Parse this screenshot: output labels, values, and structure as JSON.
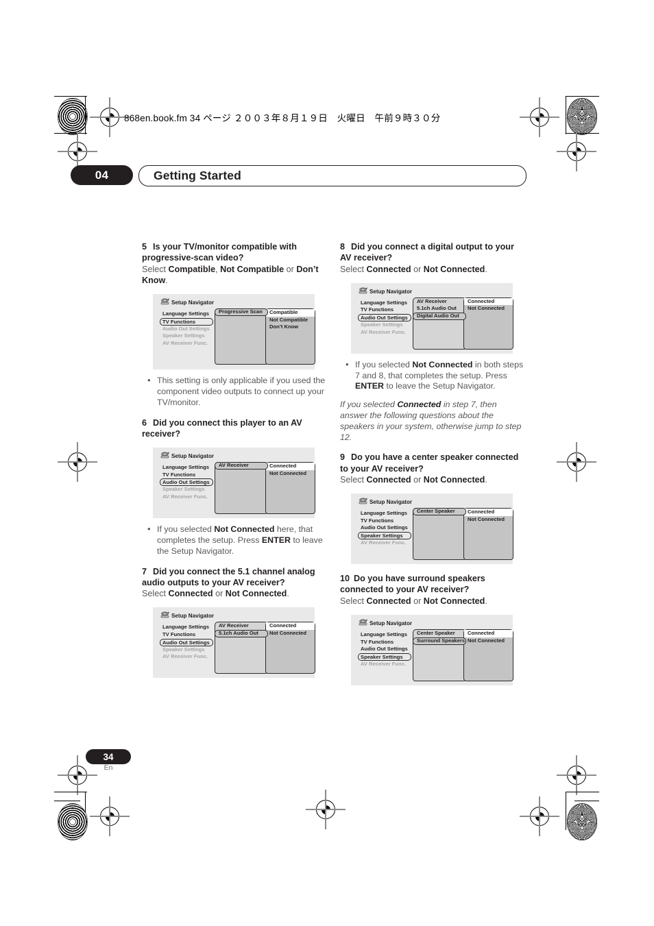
{
  "print_header": {
    "filename_line": "868en.book.fm  34 ページ  ２００３年８月１９日　火曜日　午前９時３０分"
  },
  "chapter": {
    "number": "04",
    "title": "Getting Started"
  },
  "footer": {
    "page_number": "34",
    "language_code": "En"
  },
  "osd_common": {
    "navigator_title": "Setup Navigator",
    "menu_items": [
      "Language Settings",
      "TV Functions",
      "Audio Out Settings",
      "Speaker Settings",
      "AV Receiver Func."
    ]
  },
  "left_column": {
    "step5": {
      "number": "5",
      "question": "Is your TV/monitor compatible with progressive-scan video?",
      "select_prefix": "Select ",
      "opt1": "Compatible",
      "sep1": ", ",
      "opt2": "Not Compatible",
      "sep2": " or ",
      "opt3": "Don’t Know",
      "period": ".",
      "osd": {
        "title": "Setup Navigator",
        "menu": [
          "Language Settings",
          "TV Functions",
          "Audio Out Settings",
          "Speaker Settings",
          "AV Receiver Func."
        ],
        "selected_menu_index": 1,
        "dim_from_index": 2,
        "mid_items": [
          "Progressive Scan"
        ],
        "mid_selected_index": 0,
        "right_items": [
          "Compatible",
          "Not Compatible",
          "Don’t Know"
        ],
        "right_highlight_index": 0
      }
    },
    "bullet5": {
      "text": "This setting is only applicable if you used the component video outputs to connect up your TV/monitor."
    },
    "step6": {
      "number": "6",
      "question": "Did you connect this player to an AV receiver?",
      "osd": {
        "title": "Setup Navigator",
        "menu": [
          "Language Settings",
          "TV Functions",
          "Audio Out Settings",
          "Speaker Settings",
          "AV Receiver Func."
        ],
        "selected_menu_index": 2,
        "dim_from_index": 3,
        "mid_items": [
          "AV Receiver"
        ],
        "mid_selected_index": 0,
        "right_items": [
          "Connected",
          "Not Connected"
        ],
        "right_highlight_index": 0
      }
    },
    "bullet6": {
      "part1": "If you selected ",
      "b1": "Not Connected",
      "part2": " here, that completes the setup. Press ",
      "b2": "ENTER",
      "part3": " to leave the Setup Navigator."
    },
    "step7": {
      "number": "7",
      "question": "Did you connect the 5.1 channel analog audio outputs to your AV receiver?",
      "select_prefix": "Select ",
      "opt1": "Connected",
      "sep1": " or ",
      "opt2": "Not Connected",
      "period": ".",
      "osd": {
        "title": "Setup Navigator",
        "menu": [
          "Language Settings",
          "TV Functions",
          "Audio Out Settings",
          "Speaker Settings",
          "AV Receiver Func."
        ],
        "selected_menu_index": 2,
        "dim_from_index": 3,
        "mid_items": [
          "AV Receiver",
          "5.1ch Audio Out"
        ],
        "mid_selected_index": 1,
        "right_items": [
          "Connected",
          "Not Connected"
        ],
        "right_highlight_index": 0
      }
    }
  },
  "right_column": {
    "step8": {
      "number": "8",
      "question": "Did you connect a digital output to your AV receiver?",
      "select_prefix": "Select ",
      "opt1": "Connected",
      "sep1": " or ",
      "opt2": "Not Connected",
      "period": ".",
      "osd": {
        "title": "Setup Navigator",
        "menu": [
          "Language Settings",
          "TV Functions",
          "Audio Out Settings",
          "Speaker Settings",
          "AV Receiver Func."
        ],
        "selected_menu_index": 2,
        "dim_from_index": 3,
        "mid_items": [
          "AV Receiver",
          "5.1ch Audio Out",
          "Digital Audio Out"
        ],
        "mid_selected_index": 2,
        "right_items": [
          "Connected",
          "Not Connected"
        ],
        "right_highlight_index": 0
      }
    },
    "bullet8": {
      "part1": "If you selected ",
      "b1": "Not Connected",
      "part2": " in both steps 7 and 8, that completes the setup. Press ",
      "b2": "ENTER",
      "part3": " to leave the Setup Navigator."
    },
    "note8": {
      "part1": "If you selected ",
      "b1": "Connected",
      "part2": " in step 7, then answer the following questions about the speakers in your system, otherwise jump to step 12."
    },
    "step9": {
      "number": "9",
      "question": "Do you have a center speaker connected to your AV receiver?",
      "select_prefix": "Select ",
      "opt1": "Connected",
      "sep1": " or ",
      "opt2": "Not Connected",
      "period": ".",
      "osd": {
        "title": "Setup Navigator",
        "menu": [
          "Language Settings",
          "TV Functions",
          "Audio Out Settings",
          "Speaker Settings",
          "AV Receiver Func."
        ],
        "selected_menu_index": 3,
        "dim_from_index": 4,
        "mid_items": [
          "Center Speaker"
        ],
        "mid_selected_index": 0,
        "right_items": [
          "Connected",
          "Not Connected"
        ],
        "right_highlight_index": 0
      }
    },
    "step10": {
      "number": "10",
      "question": "Do you have surround speakers connected to your AV receiver?",
      "select_prefix": "Select ",
      "opt1": "Connected",
      "sep1": " or ",
      "opt2": "Not Connected",
      "period": ".",
      "osd": {
        "title": "Setup Navigator",
        "menu": [
          "Language Settings",
          "TV Functions",
          "Audio Out Settings",
          "Speaker Settings",
          "AV Receiver Func."
        ],
        "selected_menu_index": 3,
        "dim_from_index": 4,
        "mid_items": [
          "Center Speaker",
          "Surround Speakers"
        ],
        "mid_selected_index": 1,
        "right_items": [
          "Connected",
          "Not Connected"
        ],
        "right_highlight_index": 0
      }
    }
  }
}
